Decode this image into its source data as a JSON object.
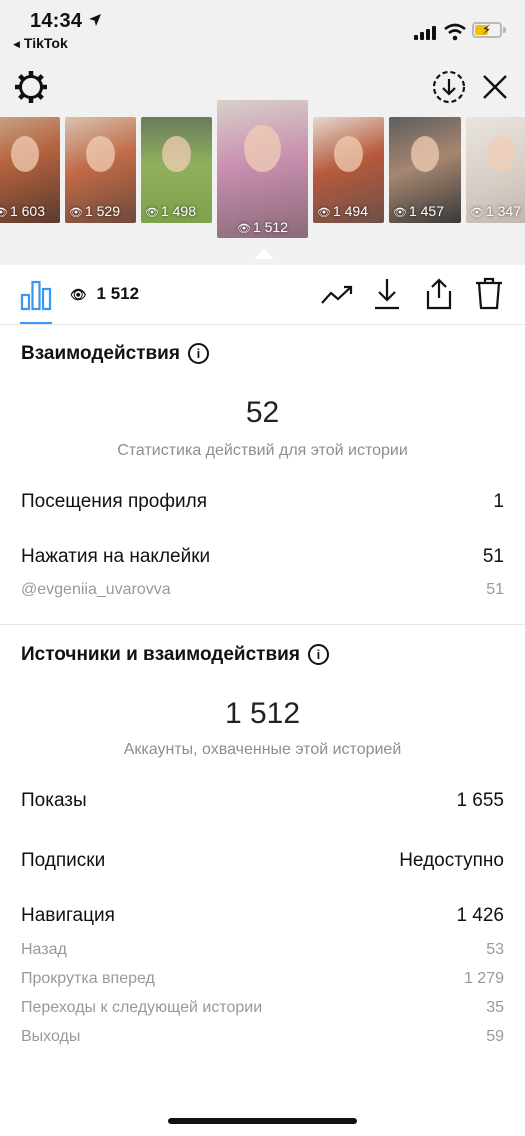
{
  "status_bar": {
    "time": "14:34",
    "back_app": "TikTok"
  },
  "thumbnails": [
    {
      "views": "1 603",
      "selected": false
    },
    {
      "views": "1 529",
      "selected": false
    },
    {
      "views": "1 498",
      "selected": false
    },
    {
      "views": "1 512",
      "selected": true
    },
    {
      "views": "1 494",
      "selected": false
    },
    {
      "views": "1 457",
      "selected": false
    },
    {
      "views": "1 347",
      "selected": false
    }
  ],
  "tabbar": {
    "views": "1 512"
  },
  "interactions": {
    "title": "Взаимодействия",
    "total": "52",
    "caption": "Статистика действий для этой истории",
    "profile_visits_label": "Посещения профиля",
    "profile_visits_value": "1",
    "sticker_taps_label": "Нажатия на наклейки",
    "sticker_taps_value": "51",
    "mention_label": "@evgeniia_uvarovva",
    "mention_value": "51"
  },
  "discovery": {
    "title": "Источники и взаимодействия",
    "total": "1 512",
    "caption": "Аккаунты, охваченные этой историей",
    "impressions_label": "Показы",
    "impressions_value": "1 655",
    "follows_label": "Подписки",
    "follows_value": "Недоступно",
    "navigation_label": "Навигация",
    "navigation_value": "1 426",
    "back_label": "Назад",
    "back_value": "53",
    "forward_label": "Прокрутка вперед",
    "forward_value": "1 279",
    "next_story_label": "Переходы к следующей истории",
    "next_story_value": "35",
    "exits_label": "Выходы",
    "exits_value": "59"
  },
  "colors": {
    "accent": "#3897f0",
    "muted_text": "#8e8e8e",
    "battery": "#f2c200"
  },
  "icons": [
    "location-arrow-icon",
    "signal-icon",
    "wifi-icon",
    "battery-icon",
    "gear-icon",
    "save-icon",
    "close-icon",
    "bar-chart-icon",
    "eye-icon",
    "trend-icon",
    "download-icon",
    "share-icon",
    "trash-icon",
    "info-icon"
  ]
}
